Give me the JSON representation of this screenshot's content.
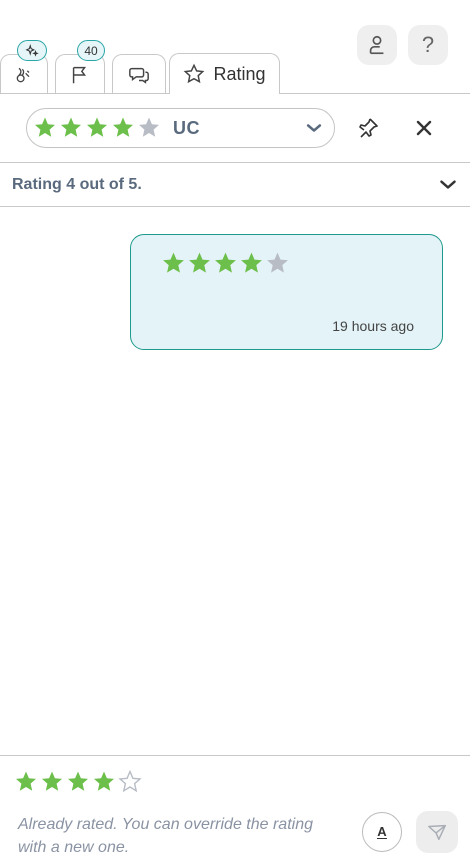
{
  "tabs": [
    {
      "id": "ai",
      "icon": "ai-sparkle-icon",
      "badge_icon": "sparkle-icon"
    },
    {
      "id": "flags",
      "icon": "flag-icon",
      "badge": "40"
    },
    {
      "id": "comments",
      "icon": "chat-bubbles-icon"
    },
    {
      "id": "rating",
      "icon": "star-outline-icon",
      "label": "Rating",
      "active": true
    }
  ],
  "top_actions": {
    "user_icon": "user-icon",
    "help_label": "?"
  },
  "selector": {
    "rating": 4,
    "max": 5,
    "label": "UC"
  },
  "summary": {
    "text": "Rating 4 out of 5."
  },
  "message": {
    "rating": 4,
    "max": 5,
    "time": "19 hours ago"
  },
  "footer": {
    "rating": 4,
    "max": 5,
    "hint": "Already rated. You can override the rating with a new one.",
    "format_label": "A"
  },
  "colors": {
    "star_filled": "#6cbf4a",
    "star_empty": "#b8bcc4",
    "accent": "#1e9a8c",
    "bubble_bg": "#e4f3f8"
  }
}
